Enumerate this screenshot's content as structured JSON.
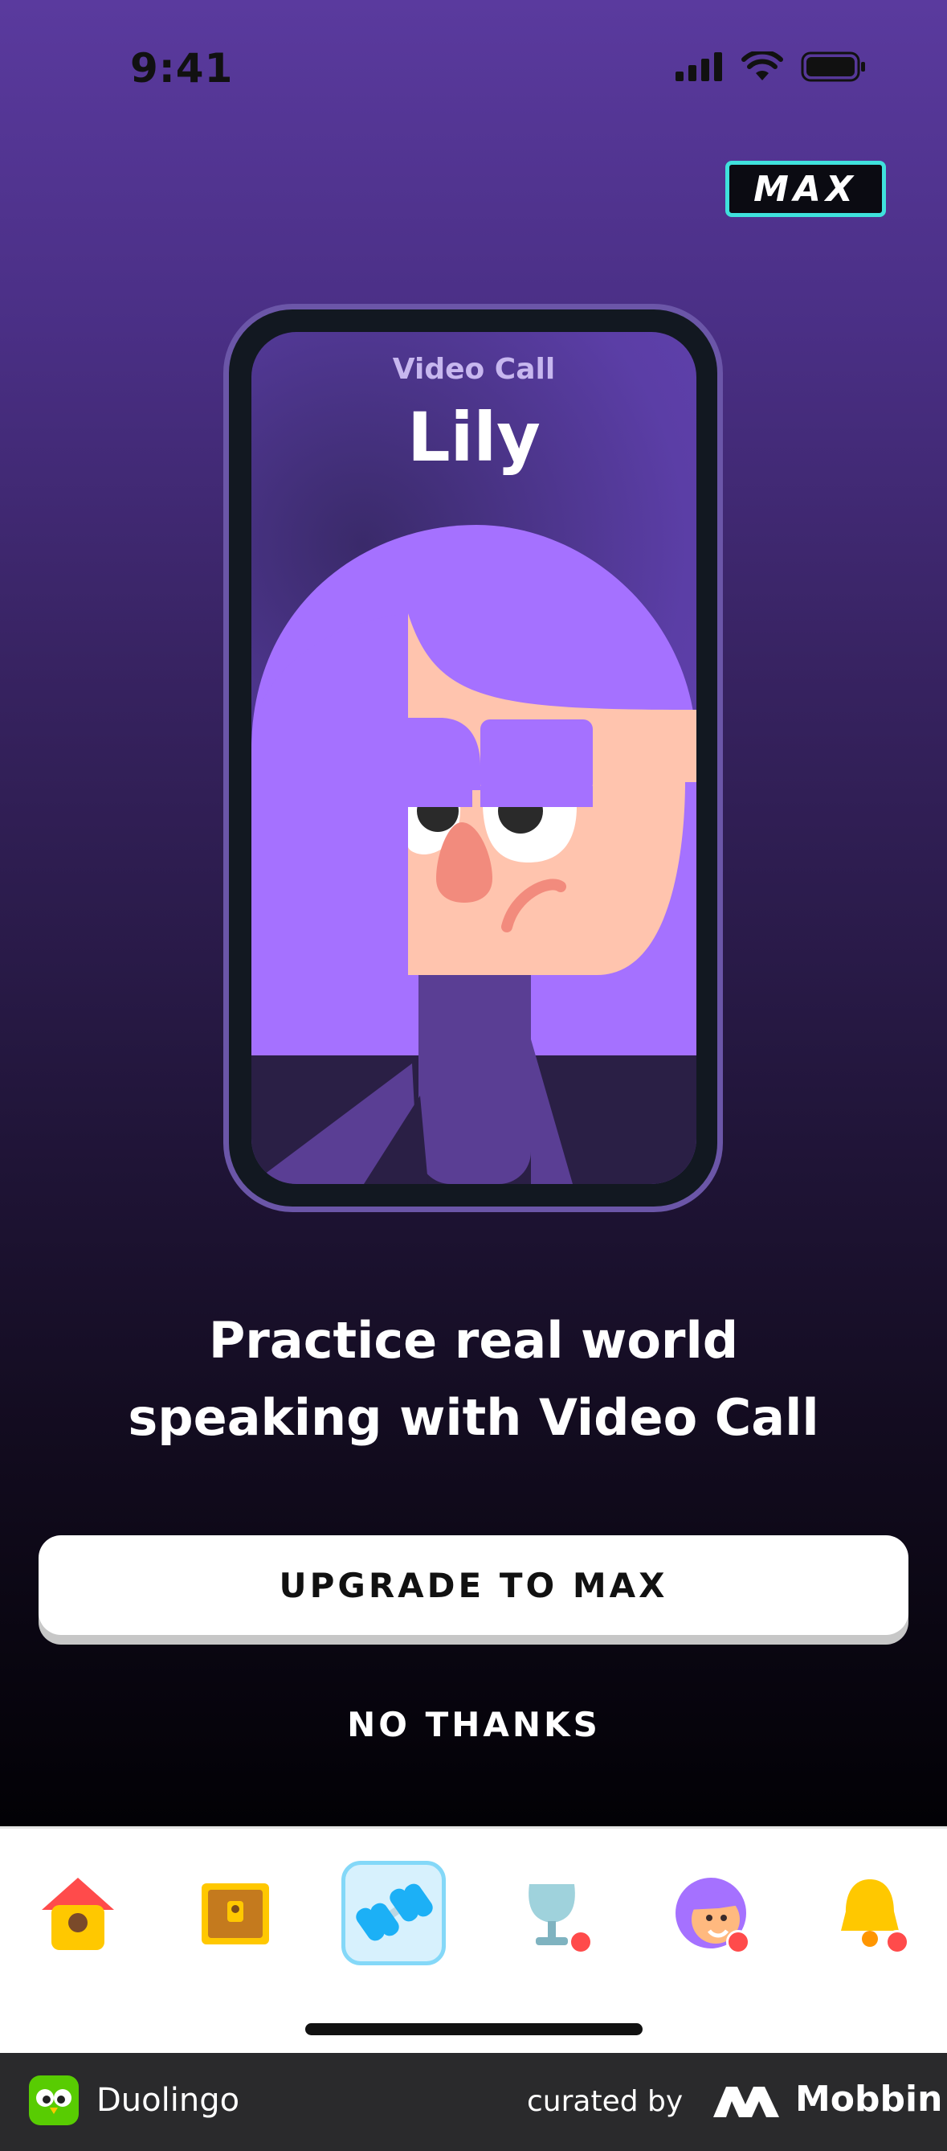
{
  "status_bar": {
    "time": "9:41"
  },
  "badge": {
    "label": "MAX"
  },
  "video_call": {
    "label": "Video Call",
    "name": "Lily"
  },
  "headline": {
    "line1": "Practice real world",
    "line2": "speaking with Video Call"
  },
  "actions": {
    "upgrade_label": "UPGRADE TO MAX",
    "dismiss_label": "NO THANKS"
  },
  "tab_bar": {
    "tabs": [
      {
        "icon": "home-birdhouse-icon",
        "selected": false,
        "notification": false
      },
      {
        "icon": "treasure-chest-icon",
        "selected": false,
        "notification": false
      },
      {
        "icon": "dumbbell-practice-icon",
        "selected": true,
        "notification": false
      },
      {
        "icon": "leaderboard-trophy-icon",
        "selected": false,
        "notification": true
      },
      {
        "icon": "profile-avatar-icon",
        "selected": false,
        "notification": true
      },
      {
        "icon": "bell-icon",
        "selected": false,
        "notification": true
      }
    ]
  },
  "footer": {
    "app_name": "Duolingo",
    "curated_by": "curated by",
    "brand": "Mobbin"
  },
  "colors": {
    "accent_purple": "#a571ff",
    "max_border": "#3fe1dc",
    "notification_red": "#ff4b4b",
    "selected_tab_bg": "#d7f1fd"
  }
}
